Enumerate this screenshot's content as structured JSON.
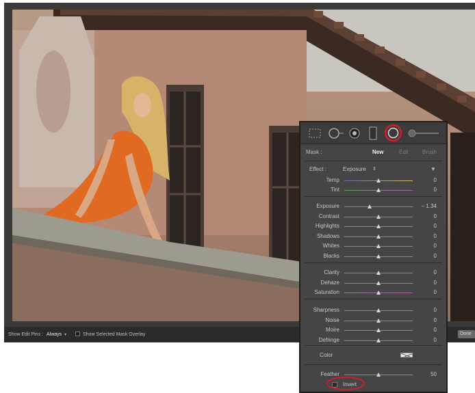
{
  "toolbar": {
    "show_edit_pins_label": "Show Edit Pins :",
    "show_edit_pins_value": "Always",
    "show_mask_overlay_label": "Show Selected Mask Overlay",
    "done_label": "Done"
  },
  "panel": {
    "tools": [
      "crop-overlay-icon",
      "spot-removal-icon",
      "red-eye-icon",
      "graduated-filter-icon",
      "radial-filter-icon",
      "adjustment-brush-icon"
    ],
    "highlight_color": "#d0202a",
    "mask": {
      "label": "Mask :",
      "options": [
        "New",
        "Edit",
        "Brush"
      ],
      "active": "New"
    },
    "effect": {
      "label": "Effect :",
      "value": "Exposure"
    },
    "sliders_group1": [
      {
        "label": "Temp",
        "value": "0",
        "pos": 0.5
      },
      {
        "label": "Tint",
        "value": "0",
        "pos": 0.5
      }
    ],
    "sliders_group2": [
      {
        "label": "Exposure",
        "value": "– 1.34",
        "pos": 0.37
      },
      {
        "label": "Contrast",
        "value": "0",
        "pos": 0.5
      },
      {
        "label": "Highlights",
        "value": "0",
        "pos": 0.5
      },
      {
        "label": "Shadows",
        "value": "0",
        "pos": 0.5
      },
      {
        "label": "Whites",
        "value": "0",
        "pos": 0.5
      },
      {
        "label": "Blacks",
        "value": "0",
        "pos": 0.5
      }
    ],
    "sliders_group3": [
      {
        "label": "Clarity",
        "value": "0",
        "pos": 0.5
      },
      {
        "label": "Dehaze",
        "value": "0",
        "pos": 0.5
      },
      {
        "label": "Saturation",
        "value": "0",
        "pos": 0.5
      }
    ],
    "sliders_group4": [
      {
        "label": "Sharpness",
        "value": "0",
        "pos": 0.5
      },
      {
        "label": "Noise",
        "value": "0",
        "pos": 0.5
      },
      {
        "label": "Moire",
        "value": "0",
        "pos": 0.5
      },
      {
        "label": "Defringe",
        "value": "0",
        "pos": 0.5
      }
    ],
    "color_label": "Color",
    "feather": {
      "label": "Feather",
      "value": "50",
      "pos": 0.5
    },
    "invert_label": "Invert"
  }
}
